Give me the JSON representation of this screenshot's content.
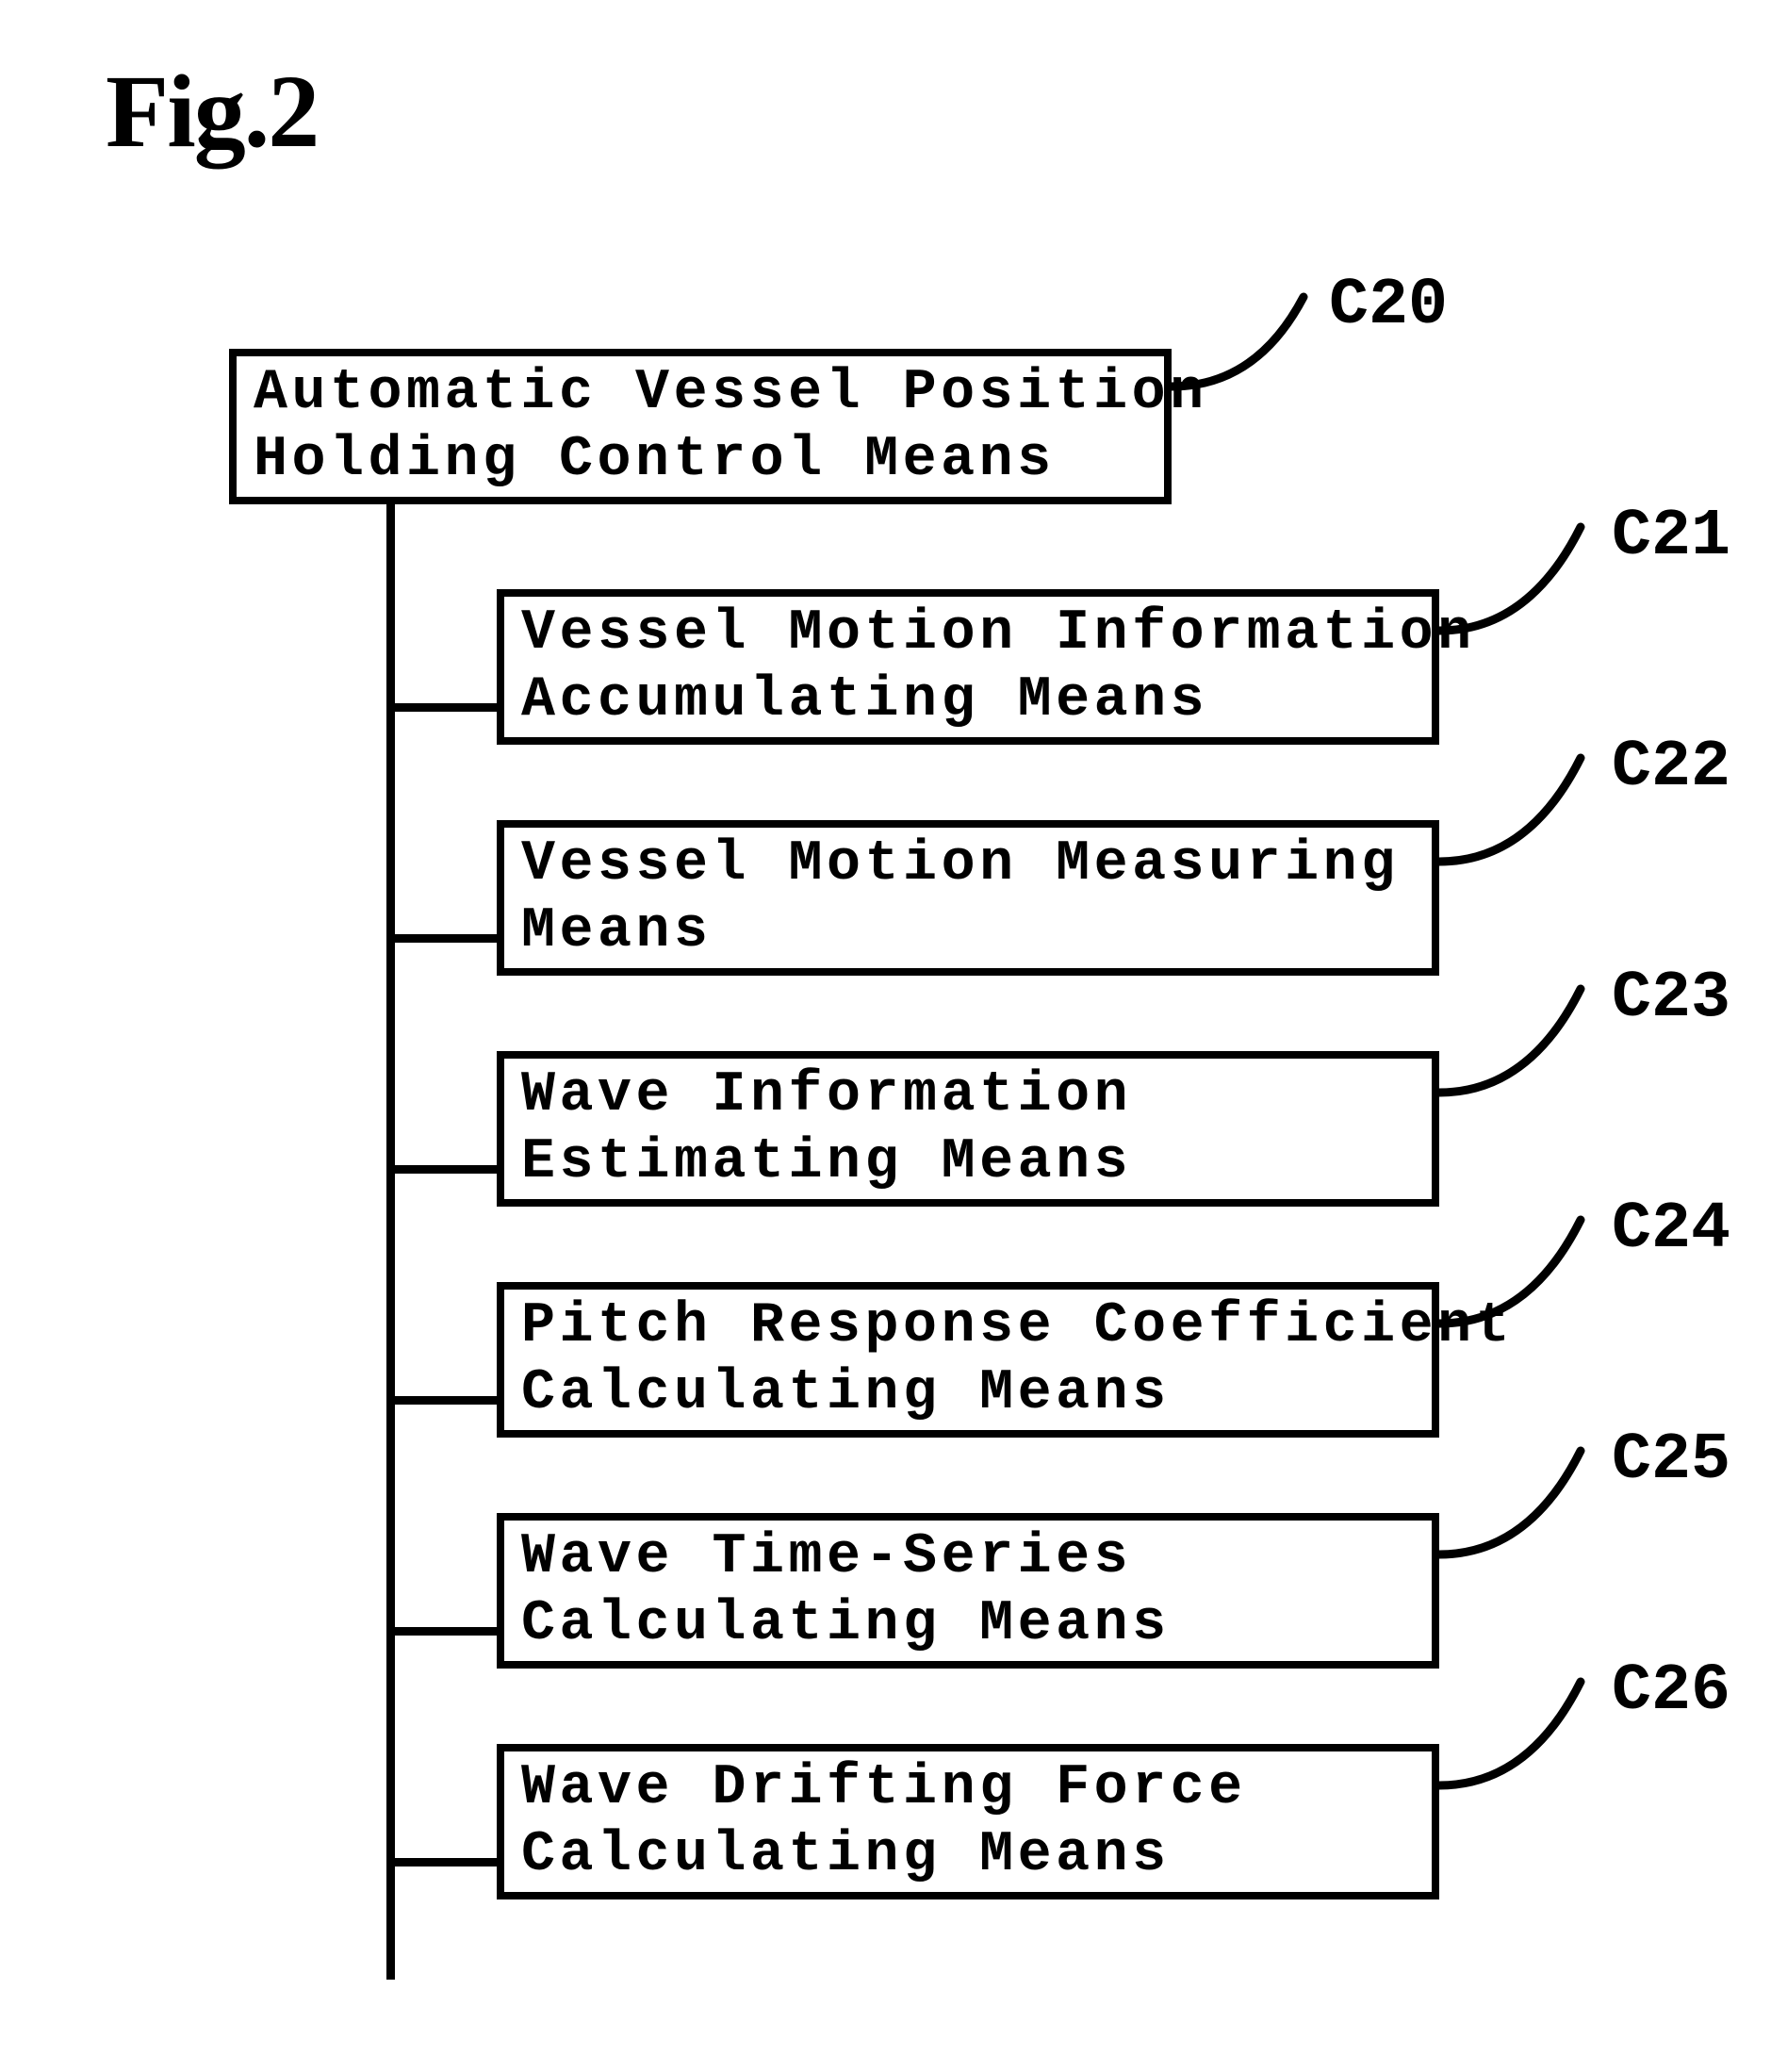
{
  "figure": {
    "title": "Fig.2"
  },
  "root": {
    "id": "C20",
    "line1": "Automatic Vessel Position",
    "line2": "Holding Control Means"
  },
  "children": [
    {
      "id": "C21",
      "line1": "Vessel Motion Information",
      "line2": "Accumulating Means"
    },
    {
      "id": "C22",
      "line1": "Vessel Motion Measuring",
      "line2": "Means"
    },
    {
      "id": "C23",
      "line1": "Wave Information",
      "line2": "Estimating Means"
    },
    {
      "id": "C24",
      "line1": "Pitch Response Coefficient",
      "line2": "Calculating Means"
    },
    {
      "id": "C25",
      "line1": "Wave Time-Series",
      "line2": "Calculating Means"
    },
    {
      "id": "C26",
      "line1": "Wave Drifting Force",
      "line2": "Calculating Means"
    }
  ]
}
